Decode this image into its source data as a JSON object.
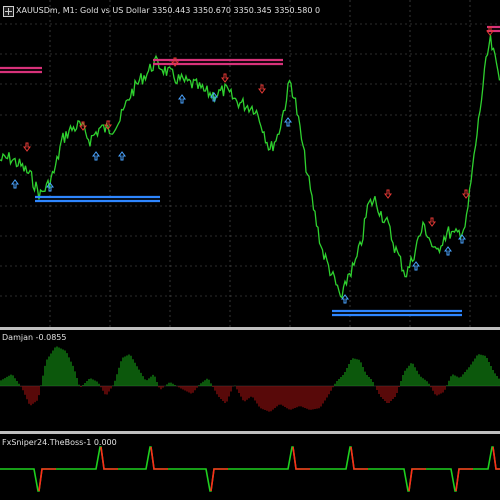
{
  "main_chart": {
    "title": "XAUUSDm, M1:  Gold vs US Dollar  3350.443 3350.670 3350.345 3350.580  0",
    "colors": {
      "background": "#000000",
      "grid": "#5a5a5a",
      "price_line": "#2fd12f",
      "up_arrow": "#4aa3ff",
      "down_arrow": "#e53935",
      "resistance_zone": "#d8327a",
      "support_zone": "#2e86ff"
    },
    "icons": [
      "chart-window-icon"
    ]
  },
  "indicator_1": {
    "title": "Damjan -0.0855",
    "colors": {
      "positive": "#18b018",
      "negative": "#b01212"
    }
  },
  "indicator_2": {
    "title": "FxSniper24.TheBoss-1 0.000",
    "colors": {
      "line_green": "#1fd11f",
      "line_red": "#ff2a1a"
    }
  }
}
